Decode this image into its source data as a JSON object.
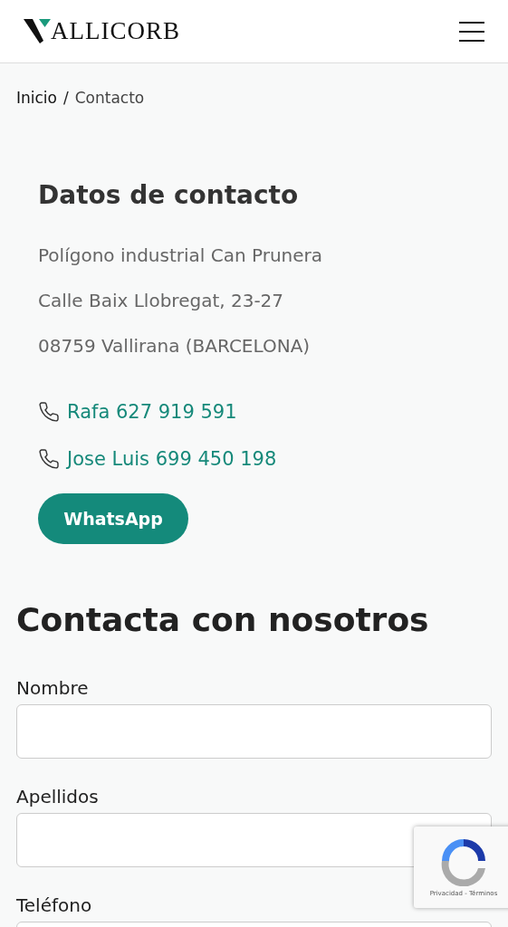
{
  "header": {
    "logo": "ALLICORB"
  },
  "breadcrumb": [
    {
      "label": "Inicio"
    },
    {
      "label": "Contacto"
    }
  ],
  "breadcrumb_separator": "/",
  "contact": {
    "title": "Datos de contacto",
    "address": [
      "Polígono industrial Can Prunera",
      "Calle Baix Llobregat, 23-27",
      "08759 Vallirana (BARCELONA)"
    ],
    "phones": [
      "Rafa 627 919 591",
      "Jose Luis 699 450 198"
    ],
    "button": "WhatsApp"
  },
  "form": {
    "title": "Contacta con nosotros",
    "fields": [
      {
        "label": "Nombre"
      },
      {
        "label": "Apellidos"
      },
      {
        "label": "Teléfono"
      }
    ]
  },
  "recaptcha": {
    "links": "Privacidad - Términos"
  }
}
